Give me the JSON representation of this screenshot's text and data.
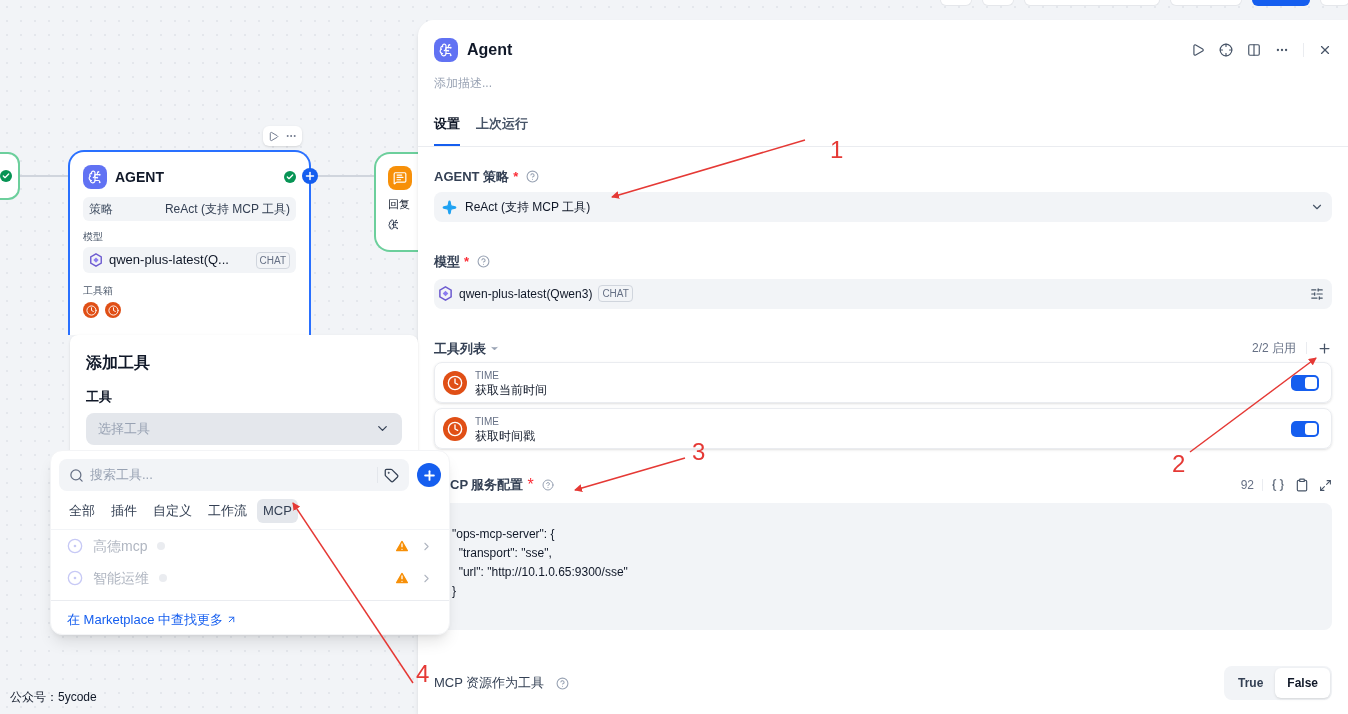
{
  "toolbar": {
    "buttons": [
      {
        "kind": "plain"
      },
      {
        "kind": "plain"
      },
      {
        "kind": "plain"
      },
      {
        "kind": "plain"
      },
      {
        "kind": "primary"
      },
      {
        "kind": "plain"
      }
    ]
  },
  "canvas": {
    "agent_node": {
      "title": "AGENT",
      "strategy_label": "策略",
      "strategy_value": "ReAct (支持 MCP 工具)",
      "model_label": "模型",
      "model": "qwen-plus-latest(Q...",
      "model_tag": "CHAT",
      "tools_label": "工具箱",
      "tools": [
        {
          "kind": "clock"
        },
        {
          "kind": "clock"
        }
      ]
    },
    "reply_node": {
      "title": "回复"
    },
    "caption": "公众号：5ycode"
  },
  "add_tool": {
    "title": "添加工具",
    "field_label": "工具",
    "placeholder": "选择工具"
  },
  "tool_picker": {
    "search_placeholder": "搜索工具...",
    "tabs": [
      {
        "label": "全部",
        "selected": false
      },
      {
        "label": "插件",
        "selected": false
      },
      {
        "label": "自定义",
        "selected": false
      },
      {
        "label": "工作流",
        "selected": false
      },
      {
        "label": "MCP",
        "selected": true
      }
    ],
    "items": [
      {
        "name": "高德mcp",
        "warning": true
      },
      {
        "name": "智能运维",
        "warning": true
      }
    ],
    "marketplace_link": "在 Marketplace 中查找更多"
  },
  "panel": {
    "title": "Agent",
    "description_placeholder": "添加描述...",
    "tabs": [
      {
        "label": "设置",
        "selected": true
      },
      {
        "label": "上次运行",
        "selected": false
      }
    ],
    "strategy": {
      "label": "AGENT 策略",
      "required_mark": "*",
      "value": "ReAct (支持 MCP 工具)"
    },
    "model": {
      "label": "模型",
      "required_mark": "*",
      "value": "qwen-plus-latest(Qwen3)",
      "tag": "CHAT"
    },
    "tool_list": {
      "label": "工具列表",
      "status": "2/2 启用",
      "tools": [
        {
          "provider": "TIME",
          "name": "获取当前时间",
          "on": true
        },
        {
          "provider": "TIME",
          "name": "获取时间戳",
          "on": true
        }
      ]
    },
    "mcp_config": {
      "label": "CP 服务配置",
      "required_mark": "*",
      "char_count": "92",
      "code_lines": [
        "\"ops-mcp-server\": {",
        "  \"transport\": \"sse\",",
        "  \"url\": \"http://10.1.0.65:9300/sse\"",
        "}"
      ]
    },
    "resource_as_tool": {
      "label": "MCP 资源作为工具",
      "options": [
        {
          "label": "True",
          "selected": false
        },
        {
          "label": "False",
          "selected": true
        }
      ]
    }
  },
  "annotations": [
    {
      "label": "1"
    },
    {
      "label": "2"
    },
    {
      "label": "3"
    },
    {
      "label": "4"
    }
  ]
}
